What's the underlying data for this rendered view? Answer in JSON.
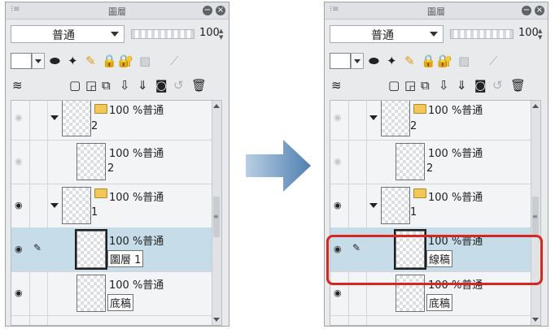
{
  "panel_left": {
    "title": "圖層",
    "blend_mode": "普通",
    "opacity": "100",
    "layers": [
      {
        "info": "100 %普通",
        "name": "2",
        "visible": false,
        "folder": true,
        "expanded": true
      },
      {
        "info": "100 %普通",
        "name": "2",
        "visible": false,
        "folder": false
      },
      {
        "info": "100 %普通",
        "name": "1",
        "visible": true,
        "folder": true,
        "expanded": true
      },
      {
        "info": "100 %普通",
        "name": "圖層 1",
        "visible": true,
        "folder": false,
        "selected": true
      },
      {
        "info": "100 %普通",
        "name": "底稿",
        "visible": true,
        "folder": false
      }
    ]
  },
  "panel_right": {
    "title": "圖層",
    "blend_mode": "普通",
    "opacity": "100",
    "layers": [
      {
        "info": "100 %普通",
        "name": "2",
        "visible": false,
        "folder": true,
        "expanded": true
      },
      {
        "info": "100 %普通",
        "name": "2",
        "visible": false,
        "folder": false
      },
      {
        "info": "100 %普通",
        "name": "1",
        "visible": true,
        "folder": true,
        "expanded": true
      },
      {
        "info": "100 %普通",
        "name": "線稿",
        "visible": true,
        "folder": false,
        "selected": true
      },
      {
        "info": "100 %普通",
        "name": "底稿",
        "visible": true,
        "folder": false
      }
    ]
  },
  "colors": {
    "selection": "#c7dce9",
    "highlight_border": "#d6261f",
    "arrow": "#6f97c0"
  },
  "icons": {
    "eye": "eye-icon",
    "pen": "pen-icon",
    "folder": "folder-icon",
    "arrow": "right-arrow-icon"
  }
}
